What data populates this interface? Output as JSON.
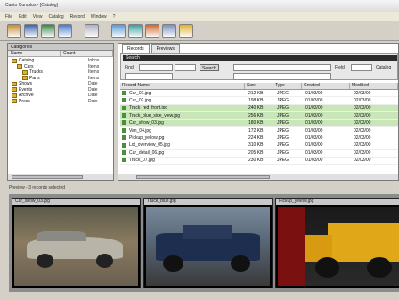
{
  "window": {
    "title": "Canto Cumulus - [Catalog]"
  },
  "menu": [
    "File",
    "Edit",
    "View",
    "Catalog",
    "Record",
    "Window",
    "?"
  ],
  "toolbar": {
    "buttons": [
      {
        "name": "new-icon",
        "color": "#c88a30"
      },
      {
        "name": "open-icon",
        "color": "#3a66b0"
      },
      {
        "name": "save-icon",
        "color": "#3a8a4a"
      },
      {
        "name": "print-icon",
        "color": "#4a7ad0"
      },
      {
        "name": "find-icon",
        "color": "#b0b0c0"
      },
      {
        "name": "catalog-icon",
        "color": "#5a9ad8"
      },
      {
        "name": "preview-icon",
        "color": "#3aa0a0"
      },
      {
        "name": "user-icon",
        "color": "#d06a30"
      },
      {
        "name": "settings-icon",
        "color": "#7a90c0"
      },
      {
        "name": "help-icon",
        "color": "#e0b030"
      }
    ]
  },
  "categories": {
    "header": "Categories",
    "columns": [
      "Name",
      "Count"
    ],
    "nodes": [
      {
        "label": "Catalog",
        "depth": 0
      },
      {
        "label": "Cars",
        "depth": 1
      },
      {
        "label": "Trucks",
        "depth": 2
      },
      {
        "label": "Parts",
        "depth": 2
      },
      {
        "label": "Shows",
        "depth": 0
      },
      {
        "label": "Events",
        "depth": 0
      },
      {
        "label": "Archive",
        "depth": 0
      },
      {
        "label": "Press",
        "depth": 0
      }
    ],
    "counts": [
      "Inbox",
      "Items",
      "Items",
      "Items",
      "Date",
      "Date",
      "Date",
      "Date"
    ]
  },
  "tabs": [
    {
      "label": "Records",
      "active": true
    },
    {
      "label": "Previews",
      "active": false
    }
  ],
  "search": {
    "title": "Search",
    "find_label": "Find",
    "button_label": "Search",
    "field_label": "Field",
    "query_value": "",
    "catalog_label": "Catalog"
  },
  "records": {
    "columns": [
      "Record Name",
      "Size",
      "Type",
      "Created",
      "Modified"
    ],
    "rows": [
      {
        "name": "Car_01.jpg",
        "size": "212 KB",
        "type": "JPEG",
        "created": "01/03/00",
        "modified": "02/03/00",
        "highlight": false
      },
      {
        "name": "Car_02.jpg",
        "size": "198 KB",
        "type": "JPEG",
        "created": "01/03/00",
        "modified": "02/03/00",
        "highlight": false
      },
      {
        "name": "Truck_red_front.jpg",
        "size": "240 KB",
        "type": "JPEG",
        "created": "01/03/00",
        "modified": "02/03/00",
        "highlight": true
      },
      {
        "name": "Truck_blue_side_view.jpg",
        "size": "256 KB",
        "type": "JPEG",
        "created": "01/03/00",
        "modified": "02/03/00",
        "highlight": true
      },
      {
        "name": "Car_show_03.jpg",
        "size": "180 KB",
        "type": "JPEG",
        "created": "01/03/00",
        "modified": "02/03/00",
        "highlight": true
      },
      {
        "name": "Van_04.jpg",
        "size": "172 KB",
        "type": "JPEG",
        "created": "01/03/00",
        "modified": "02/03/00",
        "highlight": false
      },
      {
        "name": "Pickup_yellow.jpg",
        "size": "224 KB",
        "type": "JPEG",
        "created": "01/03/00",
        "modified": "02/03/00",
        "highlight": false
      },
      {
        "name": "Lot_overview_05.jpg",
        "size": "310 KB",
        "type": "JPEG",
        "created": "01/03/00",
        "modified": "02/03/00",
        "highlight": false
      },
      {
        "name": "Car_detail_06.jpg",
        "size": "205 KB",
        "type": "JPEG",
        "created": "01/03/00",
        "modified": "02/03/00",
        "highlight": false
      },
      {
        "name": "Truck_07.jpg",
        "size": "230 KB",
        "type": "JPEG",
        "created": "01/03/00",
        "modified": "02/03/00",
        "highlight": false
      }
    ]
  },
  "preview": {
    "header": "Preview - 3 records selected",
    "items": [
      {
        "caption": "Car_show_03.jpg",
        "scene": "silver-car"
      },
      {
        "caption": "Truck_blue.jpg",
        "scene": "blue-truck"
      },
      {
        "caption": "Pickup_yellow.jpg",
        "scene": "yellow-truck"
      }
    ]
  }
}
